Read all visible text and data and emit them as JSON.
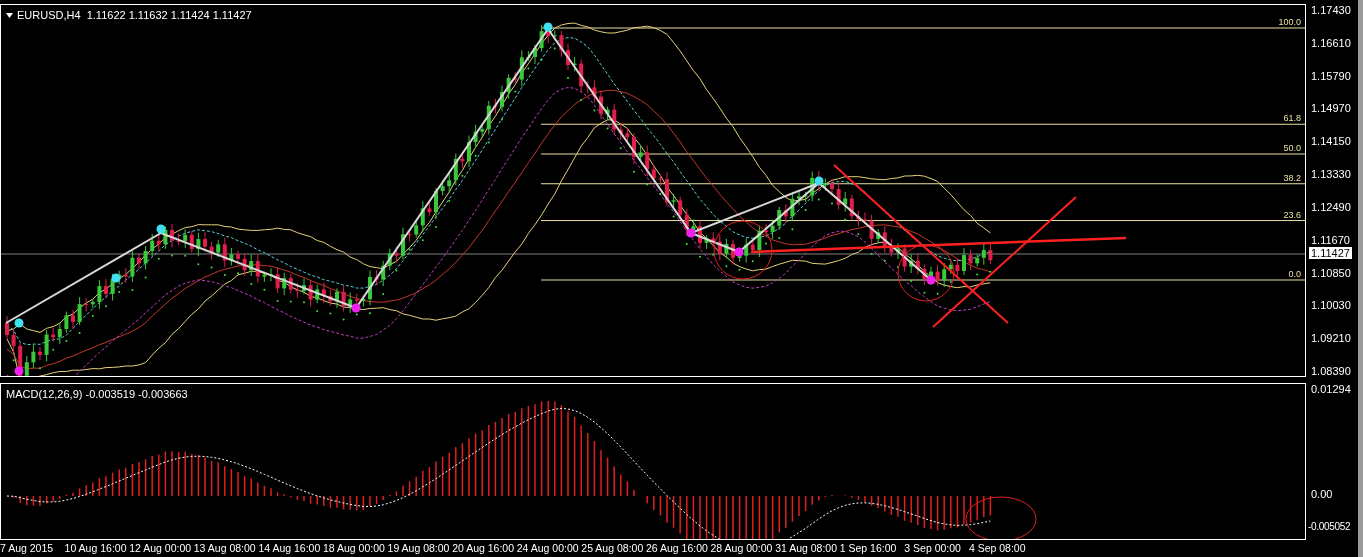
{
  "chart": {
    "title": "EURUSD,H4  1.11622 1.11632 1.11424 1.11427",
    "price_axis": [
      "1.17430",
      "1.16610",
      "1.15790",
      "1.14970",
      "1.14150",
      "1.13330",
      "1.12490",
      "1.11670",
      "1.10850",
      "1.10030",
      "1.09210",
      "1.08390"
    ],
    "current_price": "1.11427",
    "fib_levels": [
      "100.0",
      "61.8",
      "50.0",
      "38.2",
      "23.6",
      "0.0"
    ]
  },
  "macd": {
    "title": "MACD(12,26,9) -0.003519 -0.003663",
    "axis": [
      "0.01294",
      "0.00",
      "-0.005052"
    ]
  },
  "time_axis": [
    "7 Aug 2015",
    "10 Aug 16:00",
    "12 Aug 00:00",
    "13 Aug 08:00",
    "14 Aug 16:00",
    "18 Aug 00:00",
    "19 Aug 08:00",
    "20 Aug 16:00",
    "24 Aug 00:00",
    "25 Aug 08:00",
    "26 Aug 16:00",
    "28 Aug 00:00",
    "31 Aug 08:00",
    "1 Sep 16:00",
    "3 Sep 00:00",
    "4 Sep 08:00"
  ]
}
